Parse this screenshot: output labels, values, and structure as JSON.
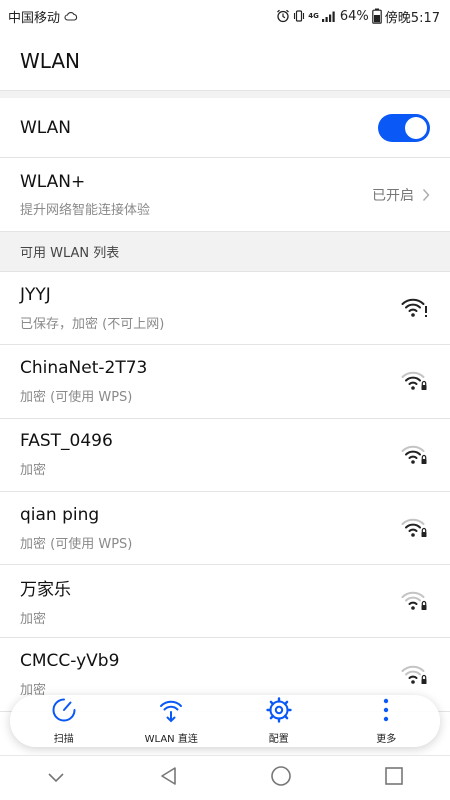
{
  "status_bar": {
    "carrier": "中国移动",
    "network": "4G",
    "battery": "64%",
    "time": "傍晚5:17"
  },
  "app_bar": {
    "title": "WLAN"
  },
  "wlan_toggle": {
    "label": "WLAN",
    "on": true
  },
  "wlan_plus": {
    "title": "WLAN+",
    "subtitle": "提升网络智能连接体验",
    "value": "已开启"
  },
  "section_header": "可用 WLAN 列表",
  "networks": [
    {
      "name": "JYYJ",
      "status": "已保存，加密 (不可上网)",
      "icon": "wifi-warning-icon"
    },
    {
      "name": "ChinaNet-2T73",
      "status": "加密 (可使用 WPS)",
      "icon": "wifi-lock-icon"
    },
    {
      "name": "FAST_0496",
      "status": "加密",
      "icon": "wifi-lock-icon"
    },
    {
      "name": "qian ping",
      "status": "加密 (可使用 WPS)",
      "icon": "wifi-lock-icon"
    },
    {
      "name": "万家乐",
      "status": "加密",
      "icon": "wifi-lock-icon"
    },
    {
      "name": "CMCC-yVb9",
      "status": "加密",
      "icon": "wifi-lock-icon"
    }
  ],
  "bottom_actions": [
    {
      "label": "扫描",
      "icon": "scan-icon"
    },
    {
      "label": "WLAN 直连",
      "icon": "wifi-direct-icon"
    },
    {
      "label": "配置",
      "icon": "gear-icon"
    },
    {
      "label": "更多",
      "icon": "more-icon"
    }
  ],
  "colors": {
    "accent": "#0a59f7",
    "secondary_text": "#8a8a8a"
  }
}
